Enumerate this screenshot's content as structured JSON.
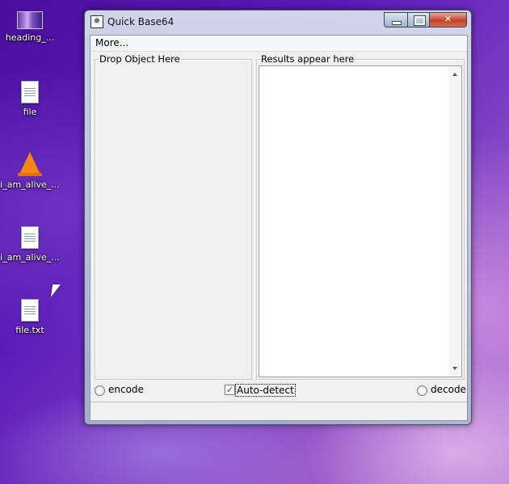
{
  "desktop": {
    "icons": [
      {
        "label": "heading_...",
        "icon": "image-file-icon"
      },
      {
        "label": "file",
        "icon": "text-document-icon"
      },
      {
        "label": "i_am_alive_...",
        "icon": "vlc-cone-icon"
      },
      {
        "label": "i_am_alive_...",
        "icon": "text-document-icon"
      },
      {
        "label": "file.txt",
        "icon": "text-document-icon"
      }
    ]
  },
  "window": {
    "title": "Quick Base64",
    "menu": {
      "more_label": "More..."
    },
    "drop_panel": {
      "legend": "Drop Object Here"
    },
    "results_panel": {
      "legend": "Results appear here",
      "content": ""
    },
    "options": {
      "encode_label": "encode",
      "encode_selected": false,
      "auto_detect_label": "Auto-detect",
      "auto_detect_checked": true,
      "decode_label": "decode",
      "decode_selected": false
    },
    "status": ""
  }
}
